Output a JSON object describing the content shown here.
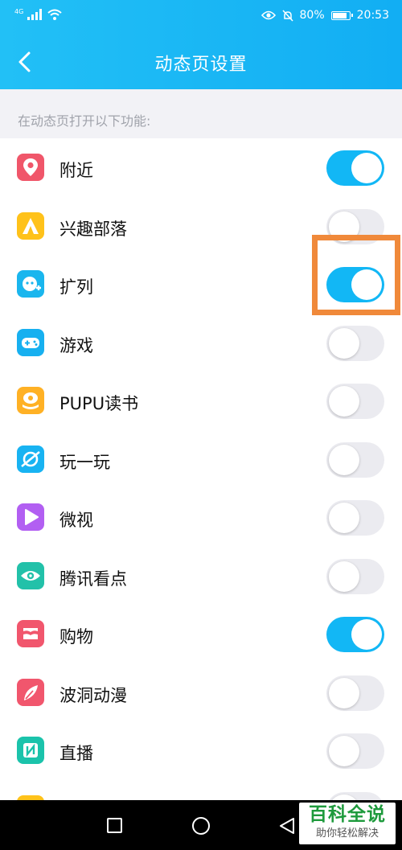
{
  "status_bar": {
    "network_label": "4G",
    "battery_text": "80%",
    "battery_level": 0.8,
    "time": "20:53",
    "icons": [
      "signal-icon",
      "wifi-icon",
      "eye-icon",
      "mute-icon",
      "battery-icon"
    ]
  },
  "header": {
    "title": "动态页设置",
    "back_icon": "chevron-left-icon",
    "background": "#18b6f5"
  },
  "section_hint": "在动态页打开以下功能:",
  "items": [
    {
      "key": "nearby",
      "label": "附近",
      "enabled": true,
      "icon": "location-pin-icon",
      "icon_color": "#f0566a"
    },
    {
      "key": "interest-tribe",
      "label": "兴趣部落",
      "enabled": false,
      "icon": "tent-icon",
      "icon_color": "#ffc21a"
    },
    {
      "key": "expand",
      "label": "扩列",
      "enabled": true,
      "icon": "expand-friends-icon",
      "icon_color": "#1ab6ee"
    },
    {
      "key": "games",
      "label": "游戏",
      "enabled": false,
      "icon": "gamepad-icon",
      "icon_color": "#17b0f0"
    },
    {
      "key": "pupu-reading",
      "label": "PUPU读书",
      "enabled": false,
      "icon": "book-icon",
      "icon_color": "#ffb125"
    },
    {
      "key": "play",
      "label": "玩一玩",
      "enabled": false,
      "icon": "planet-icon",
      "icon_color": "#18b3f2"
    },
    {
      "key": "weishi",
      "label": "微视",
      "enabled": false,
      "icon": "play-icon",
      "icon_color": "#b25ff2"
    },
    {
      "key": "tencent-news",
      "label": "腾讯看点",
      "enabled": false,
      "icon": "eye-icon",
      "icon_color": "#22c1a9"
    },
    {
      "key": "shopping",
      "label": "购物",
      "enabled": true,
      "icon": "shopping-icon",
      "icon_color": "#f1566d"
    },
    {
      "key": "bodong-anime",
      "label": "波洞动漫",
      "enabled": false,
      "icon": "feather-icon",
      "icon_color": "#f1566d"
    },
    {
      "key": "live",
      "label": "直播",
      "enabled": false,
      "icon": "live-icon",
      "icon_color": "#1bc3ab"
    },
    {
      "key": "partial",
      "label": "",
      "enabled": false,
      "icon": "star-icon",
      "icon_color": "#ffc21a"
    }
  ],
  "highlight_color": "#f0893a",
  "system_nav": {
    "icons": [
      "recent-apps-icon",
      "home-icon",
      "back-triangle-icon"
    ]
  },
  "watermark": {
    "top": "百科全说",
    "bottom": "助你轻松解决"
  }
}
